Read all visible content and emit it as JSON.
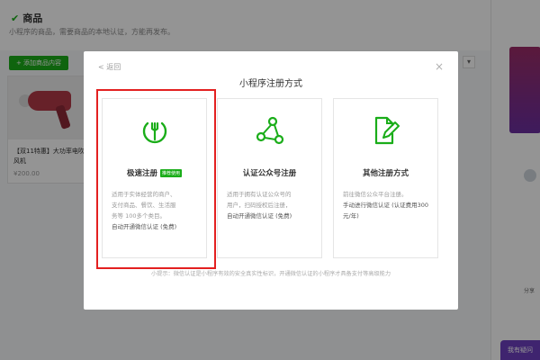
{
  "background": {
    "page_title": "商品",
    "subtitle": "小程序的商品，需要商品的本地认证，方能再发布。",
    "add_button": "+ 添加商品内容",
    "product_name": "【双11特惠】大功率电吹风机",
    "product_price": "¥200.00",
    "side_label": "分享",
    "float_button": "我有疑问"
  },
  "modal": {
    "back_label": "< 返回",
    "close_label": "×",
    "title": "小程序注册方式",
    "options": [
      {
        "name": "极速注册",
        "tag": "推荐使用",
        "desc_lines": [
          "适用于实体经营的商户、",
          "支付商品、餐饮、生活服",
          "务等 100多个类目。"
        ],
        "desc_strong": "自动开通微信认证 (免费)",
        "icon": "fork-leaf-icon"
      },
      {
        "name": "认证公众号注册",
        "tag": "",
        "desc_lines": [
          "适用于拥有认证公众号的",
          "用户，扫码授权后注册，"
        ],
        "desc_strong": "自动开通微信认证 (免费)",
        "icon": "share-nodes-icon"
      },
      {
        "name": "其他注册方式",
        "tag": "",
        "desc_lines": [
          "前往微信公众平台注册。"
        ],
        "desc_strong": "手动进行微信认证 (认证费用300元/年)",
        "icon": "edit-document-icon"
      }
    ],
    "footer": "小提示：微信认证是小程序有效的安全真实性标识，开通微信认证的小程序才具备支付等高级能力"
  },
  "colors": {
    "accent_green": "#1aad19",
    "highlight_red": "#e32020"
  }
}
